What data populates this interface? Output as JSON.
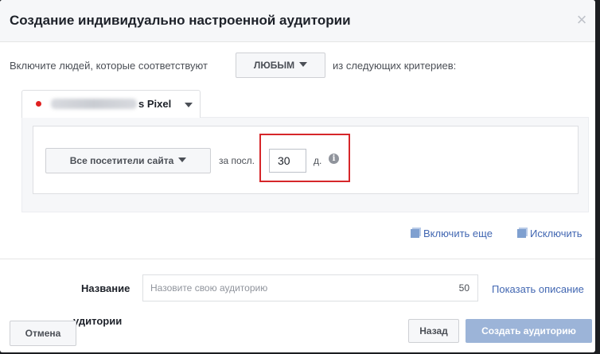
{
  "dialog": {
    "title": "Создание индивидуально настроенной аудитории",
    "close_glyph": "×"
  },
  "criteria": {
    "prefix": "Включите людей, которые соответствуют",
    "match_value": "ЛЮБЫМ",
    "suffix": "из следующих критериев:"
  },
  "pixel": {
    "name_suffix": "s Pixel",
    "status_color": "#e02020"
  },
  "rule": {
    "event_value": "Все посетители сайта",
    "for_last_label": "за посл.",
    "days_value": "30",
    "days_unit": "д.",
    "info_glyph": "i"
  },
  "actions": {
    "include_more": "Включить еще",
    "exclude": "Исключить"
  },
  "name_field": {
    "label": "Название",
    "placeholder": "Назовите свою аудиторию",
    "char_limit": "50",
    "show_description": "Показать описание"
  },
  "footer": {
    "partial_label": "удитории",
    "cancel": "Отмена",
    "back": "Назад",
    "create": "Создать аудиторию"
  },
  "colors": {
    "link": "#4267b2",
    "highlight": "#d6262a",
    "primary_disabled": "#9cb4d8"
  }
}
